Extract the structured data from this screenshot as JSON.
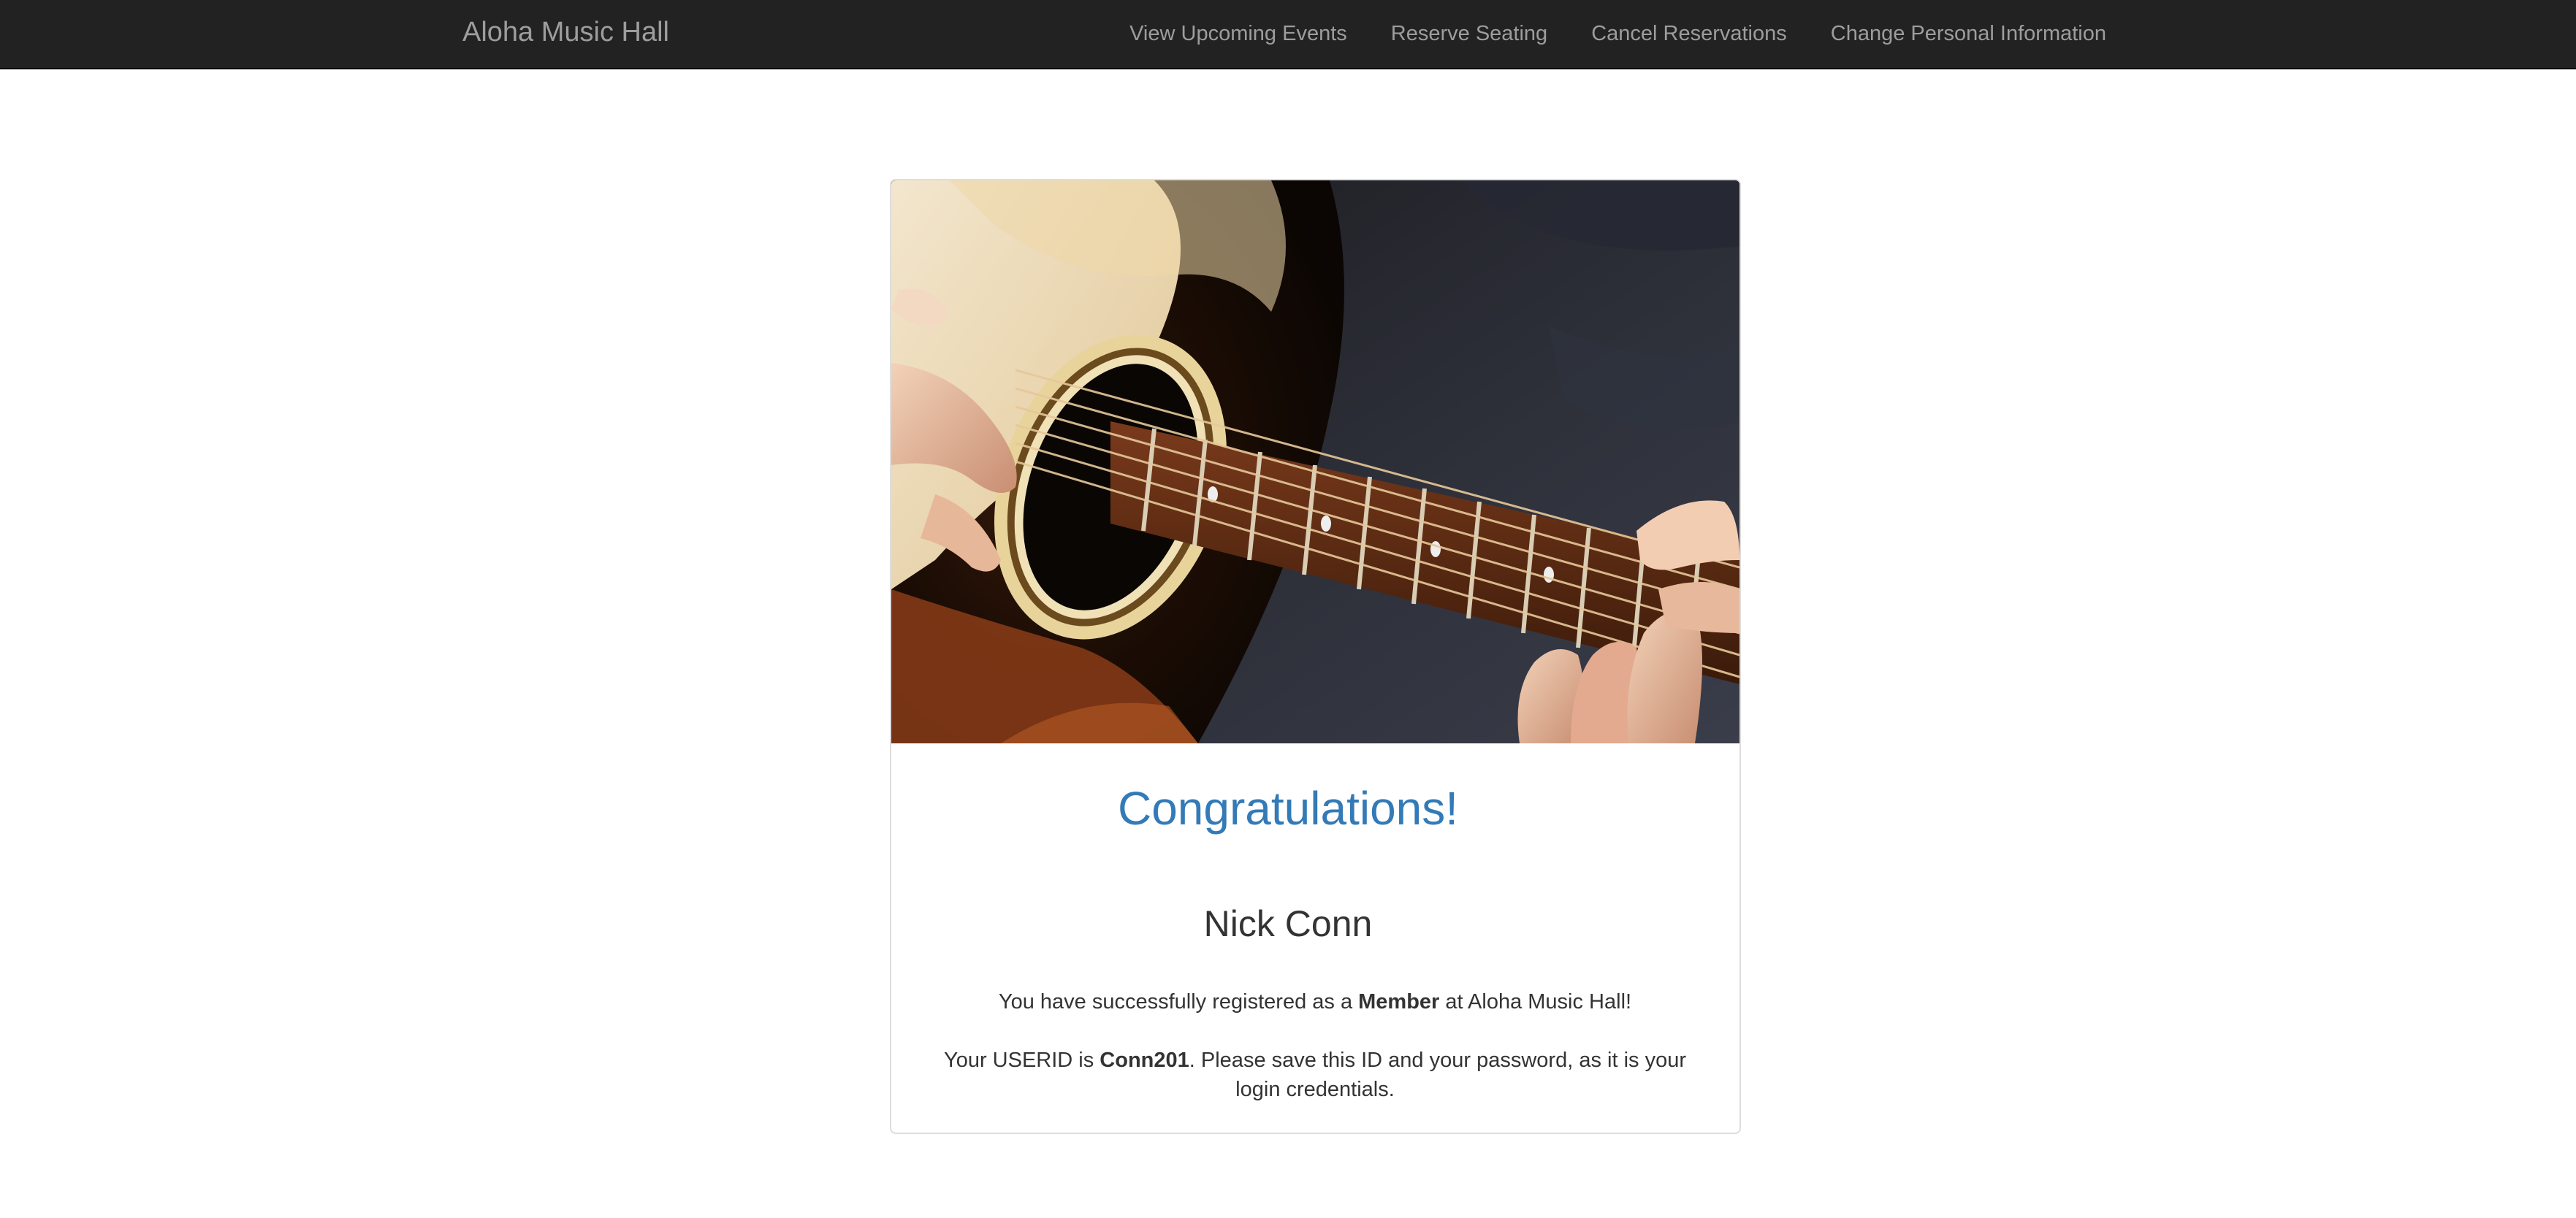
{
  "navbar": {
    "brand": "Aloha Music Hall",
    "links": [
      "View Upcoming Events",
      "Reserve Seating",
      "Cancel Reservations",
      "Change Personal Information"
    ]
  },
  "card": {
    "image_icon": "guitar-photo",
    "heading": "Congratulations!",
    "name": "Nick Conn",
    "registration": {
      "prefix": "You have successfully registered as a ",
      "role": "Member",
      "suffix": " at Aloha Music Hall!"
    },
    "userid": {
      "prefix": "Your USERID is ",
      "id": "Conn201",
      "suffix": ". Please save this ID and your password, as it is your login credentials."
    }
  },
  "colors": {
    "navbar_bg": "#222222",
    "nav_text": "#9d9d9d",
    "heading": "#337ab7",
    "body_text": "#333333"
  }
}
